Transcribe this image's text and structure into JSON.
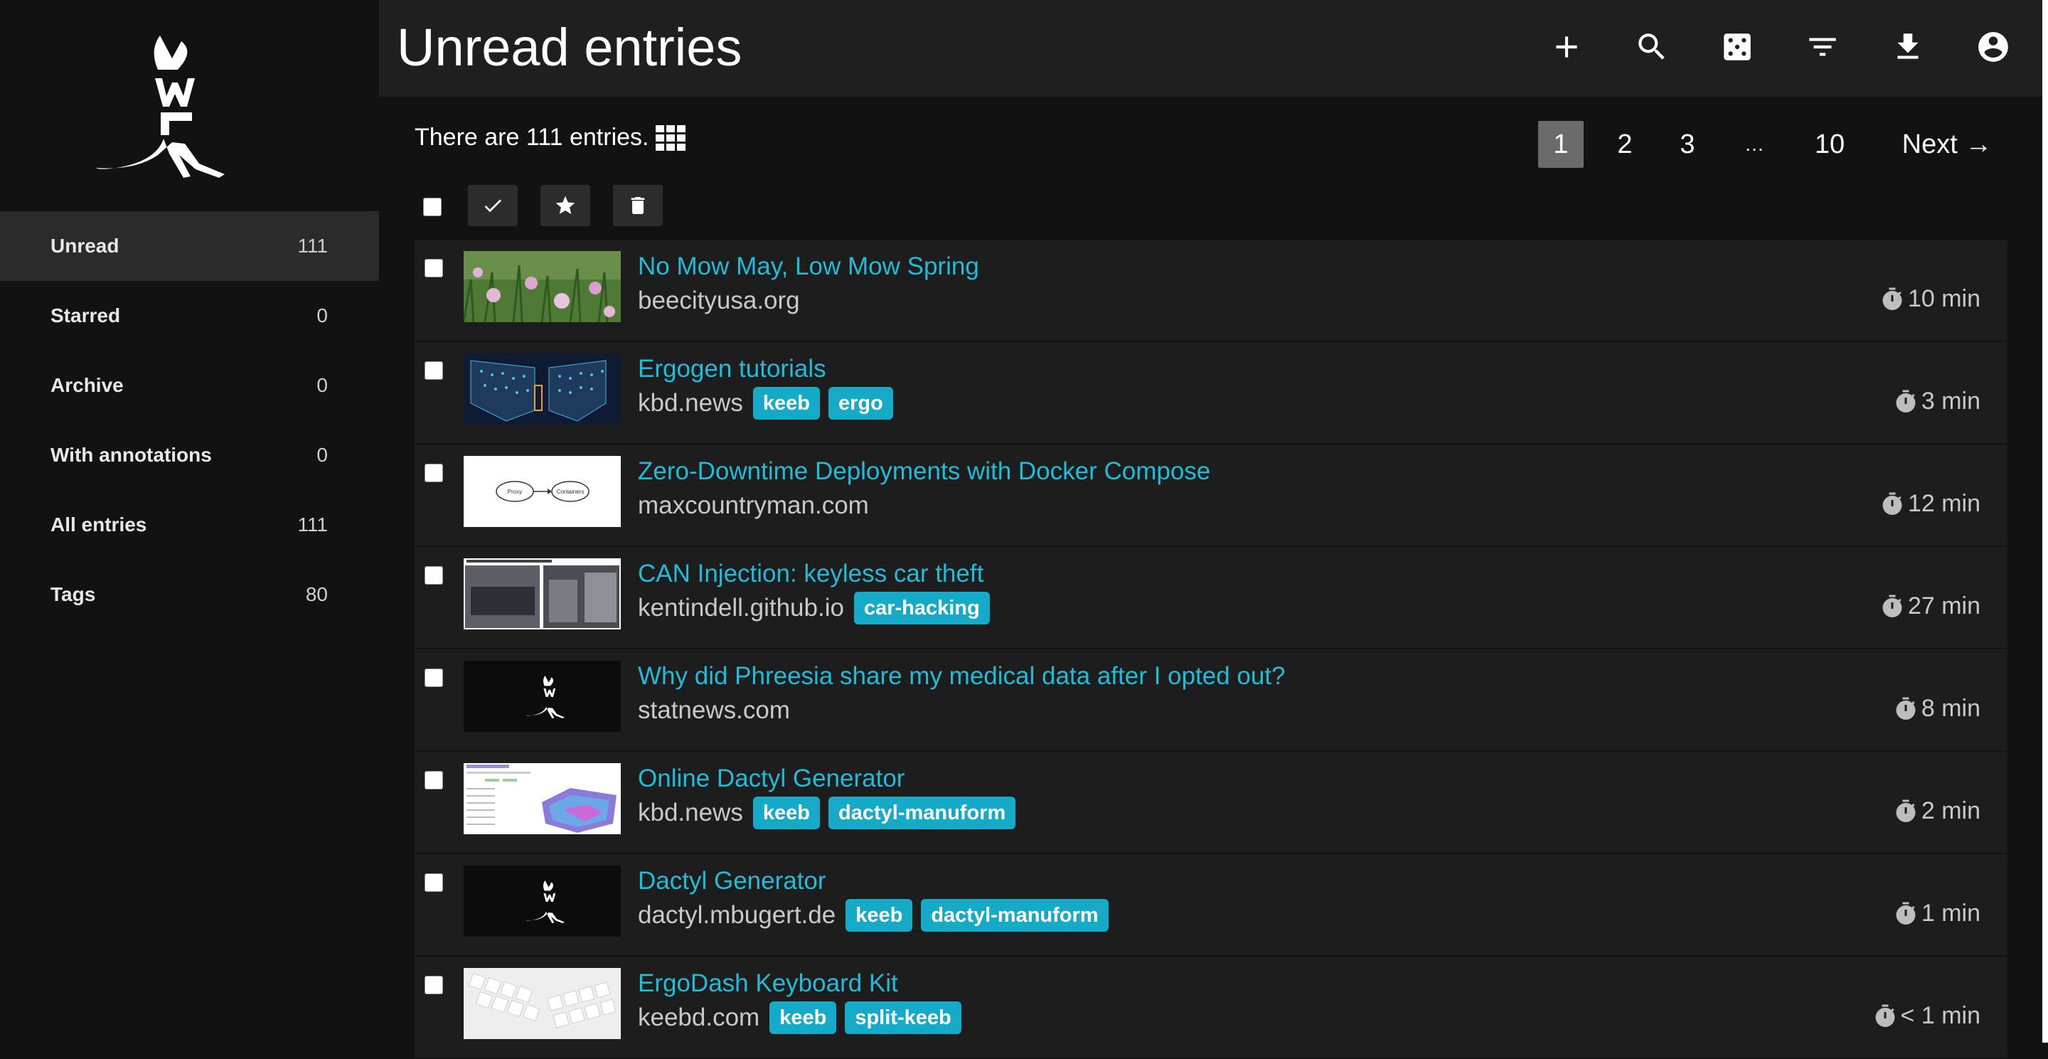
{
  "app": {
    "title": "Unread entries"
  },
  "sidebar": {
    "items": [
      {
        "label": "Unread",
        "count": "111"
      },
      {
        "label": "Starred",
        "count": "0"
      },
      {
        "label": "Archive",
        "count": "0"
      },
      {
        "label": "With annotations",
        "count": "0"
      },
      {
        "label": "All entries",
        "count": "111"
      },
      {
        "label": "Tags",
        "count": "80"
      }
    ]
  },
  "header": {
    "actions": [
      "plus-icon",
      "search-icon",
      "dice-icon",
      "filter-icon",
      "download-icon",
      "account-icon"
    ]
  },
  "main": {
    "count_text": "There are 111 entries.",
    "pagination": {
      "pages": [
        "1",
        "2",
        "3",
        "…",
        "10"
      ],
      "current": "1",
      "next_label": "Next →"
    },
    "entries": [
      {
        "title": "No Mow May, Low Mow Spring",
        "domain": "beecityusa.org",
        "tags": [],
        "reading_time": "10 min"
      },
      {
        "title": "Ergogen tutorials",
        "domain": "kbd.news",
        "tags": [
          "keeb",
          "ergo"
        ],
        "reading_time": "3 min"
      },
      {
        "title": "Zero-Downtime Deployments with Docker Compose",
        "domain": "maxcountryman.com",
        "tags": [],
        "reading_time": "12 min"
      },
      {
        "title": "CAN Injection: keyless car theft",
        "domain": "kentindell.github.io",
        "tags": [
          "car-hacking"
        ],
        "reading_time": "27 min"
      },
      {
        "title": "Why did Phreesia share my medical data after I opted out?",
        "domain": "statnews.com",
        "tags": [],
        "reading_time": "8 min"
      },
      {
        "title": "Online Dactyl Generator",
        "domain": "kbd.news",
        "tags": [
          "keeb",
          "dactyl-manuform"
        ],
        "reading_time": "2 min"
      },
      {
        "title": "Dactyl Generator",
        "domain": "dactyl.mbugert.de",
        "tags": [
          "keeb",
          "dactyl-manuform"
        ],
        "reading_time": "1 min"
      },
      {
        "title": "ErgoDash Keyboard Kit",
        "domain": "keebd.com",
        "tags": [
          "keeb",
          "split-keeb"
        ],
        "reading_time": "< 1 min"
      }
    ],
    "thumb_diagram": {
      "left": "Proxy",
      "right": "Containers"
    }
  },
  "colors": {
    "accent": "#22bcd8",
    "tag": "#15aac7",
    "sidebar_active": "#2b2b2b",
    "header": "#1f1f1f"
  }
}
